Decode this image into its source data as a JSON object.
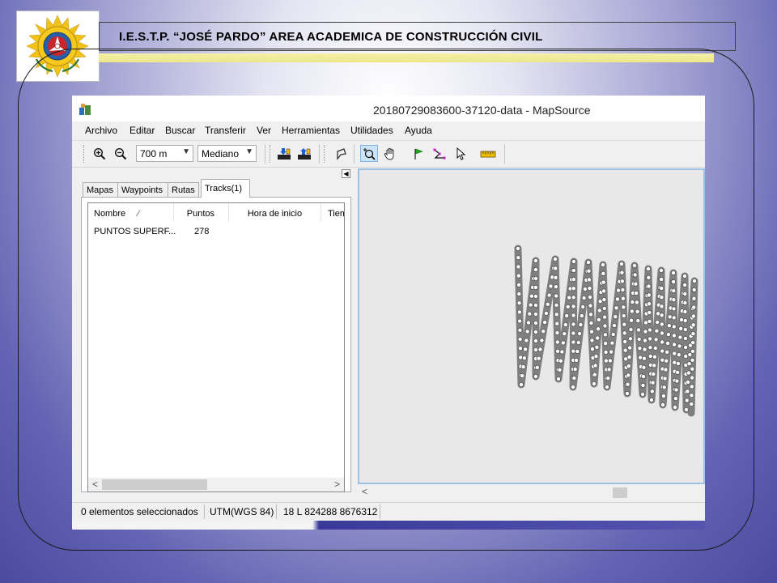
{
  "header": {
    "title": "I.E.S.T.P. “JOSÉ PARDO” AREA ACADEMICA DE CONSTRUCCIÓN CIVIL",
    "logo_icon": "institution-emblem-icon"
  },
  "window": {
    "title": "20180729083600-37120-data - MapSource",
    "menu": [
      "Archivo",
      "Editar",
      "Buscar",
      "Transferir",
      "Ver",
      "Herramientas",
      "Utilidades",
      "Ayuda"
    ],
    "toolbar": {
      "zoom_scale": "700 m",
      "detail_level": "Mediano"
    },
    "tabs": [
      "Mapas",
      "Waypoints",
      "Rutas",
      "Tracks(1)"
    ],
    "active_tab": "Tracks(1)",
    "table": {
      "columns": [
        "Nombre",
        "Puntos",
        "Hora de inicio",
        "Tiem"
      ],
      "sort_indicator": "⁄",
      "rows": [
        {
          "name": "PUNTOS SUPERF...",
          "points": "278"
        }
      ]
    },
    "status": {
      "selection": "0 elementos seleccionados",
      "datum": "UTM(WGS 84)",
      "coordinates": "18 L 824288 8676312"
    },
    "colors": {
      "track": "#7f7f7f",
      "map_border": "#9cc3e5",
      "accent_blue": "#4a4aa0"
    }
  }
}
